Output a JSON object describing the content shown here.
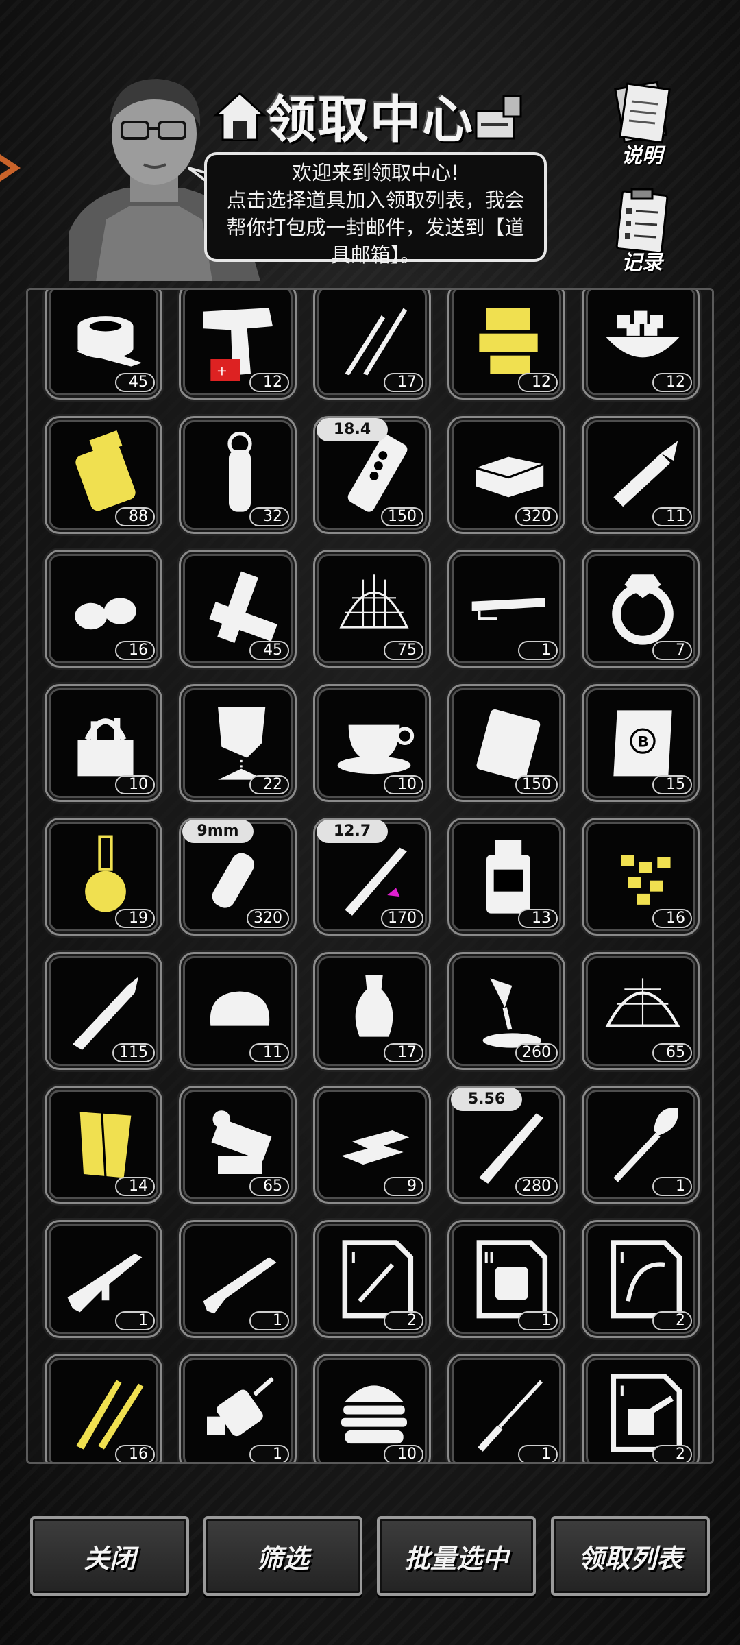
{
  "header": {
    "title": "领取中心",
    "bubble_lines": [
      "欢迎来到领取中心!",
      "点击选择道具加入领取列表，我会",
      "帮你打包成一封邮件，发送到【道",
      "具邮箱】。"
    ],
    "side_buttons": [
      {
        "label": "说明",
        "icon": "document-stack-icon"
      },
      {
        "label": "记录",
        "icon": "clipboard-icon"
      }
    ]
  },
  "items": [
    {
      "icon": "bandage-roll-icon",
      "count": "45"
    },
    {
      "icon": "flare-gun-icon",
      "count": "12"
    },
    {
      "icon": "claw-scratch-icon",
      "count": "17"
    },
    {
      "icon": "gold-parts-icon",
      "count": "12",
      "color": "#f0e050"
    },
    {
      "icon": "sugar-bowl-icon",
      "count": "12"
    },
    {
      "icon": "gold-cylinder-icon",
      "count": "88",
      "color": "#f0e050"
    },
    {
      "icon": "grenade-icon",
      "count": "32"
    },
    {
      "icon": "large-shell-icon",
      "count": "150",
      "tag": "18.4"
    },
    {
      "icon": "bullion-box-icon",
      "count": "320"
    },
    {
      "icon": "glue-tube-icon",
      "count": "11"
    },
    {
      "icon": "seeds-icon",
      "count": "16"
    },
    {
      "icon": "wood-planks-icon",
      "count": "45"
    },
    {
      "icon": "net-trap-icon",
      "count": "75"
    },
    {
      "icon": "bar-part-icon",
      "count": "1"
    },
    {
      "icon": "diamond-ring-icon",
      "count": "7"
    },
    {
      "icon": "tool-bag-icon",
      "count": "10"
    },
    {
      "icon": "sand-funnel-icon",
      "count": "22"
    },
    {
      "icon": "coffee-cup-icon",
      "count": "10"
    },
    {
      "icon": "pouch-icon",
      "count": "150"
    },
    {
      "icon": "scroll-icon",
      "count": "15"
    },
    {
      "icon": "flask-icon",
      "count": "19",
      "color": "#f0e050"
    },
    {
      "icon": "pistol-round-icon",
      "count": "320",
      "tag": "9mm"
    },
    {
      "icon": "rifle-round-icon",
      "count": "170",
      "tag": "12.7"
    },
    {
      "icon": "bottle-icon",
      "count": "13"
    },
    {
      "icon": "gold-nuggets-icon",
      "count": "16",
      "color": "#f0e050"
    },
    {
      "icon": "rpg-rocket-icon",
      "count": "115"
    },
    {
      "icon": "bread-icon",
      "count": "11"
    },
    {
      "icon": "vase-icon",
      "count": "17"
    },
    {
      "icon": "paint-spill-icon",
      "count": "260"
    },
    {
      "icon": "spike-net-icon",
      "count": "65"
    },
    {
      "icon": "gold-cloth-icon",
      "count": "14",
      "color": "#f0e050"
    },
    {
      "icon": "machine-parts-icon",
      "count": "65"
    },
    {
      "icon": "gold-bars-icon",
      "count": "9"
    },
    {
      "icon": "long-round-icon",
      "count": "280",
      "tag": "5.56"
    },
    {
      "icon": "shovel-icon",
      "count": "1"
    },
    {
      "icon": "assault-rifle-icon",
      "count": "1"
    },
    {
      "icon": "shotgun-icon",
      "count": "1"
    },
    {
      "icon": "blueprint-sword-icon",
      "count": "2"
    },
    {
      "icon": "blueprint-armor-icon",
      "count": "1"
    },
    {
      "icon": "blueprint-bow-icon",
      "count": "2"
    },
    {
      "icon": "gold-blades-icon",
      "count": "16",
      "color": "#f0e050"
    },
    {
      "icon": "drill-icon",
      "count": "1"
    },
    {
      "icon": "burger-icon",
      "count": "10"
    },
    {
      "icon": "screwdriver-icon",
      "count": "1"
    },
    {
      "icon": "blueprint-turret-icon",
      "count": "2"
    }
  ],
  "buttons": [
    {
      "label": "关闭"
    },
    {
      "label": "筛选"
    },
    {
      "label": "批量选中"
    },
    {
      "label": "领取列表"
    }
  ]
}
